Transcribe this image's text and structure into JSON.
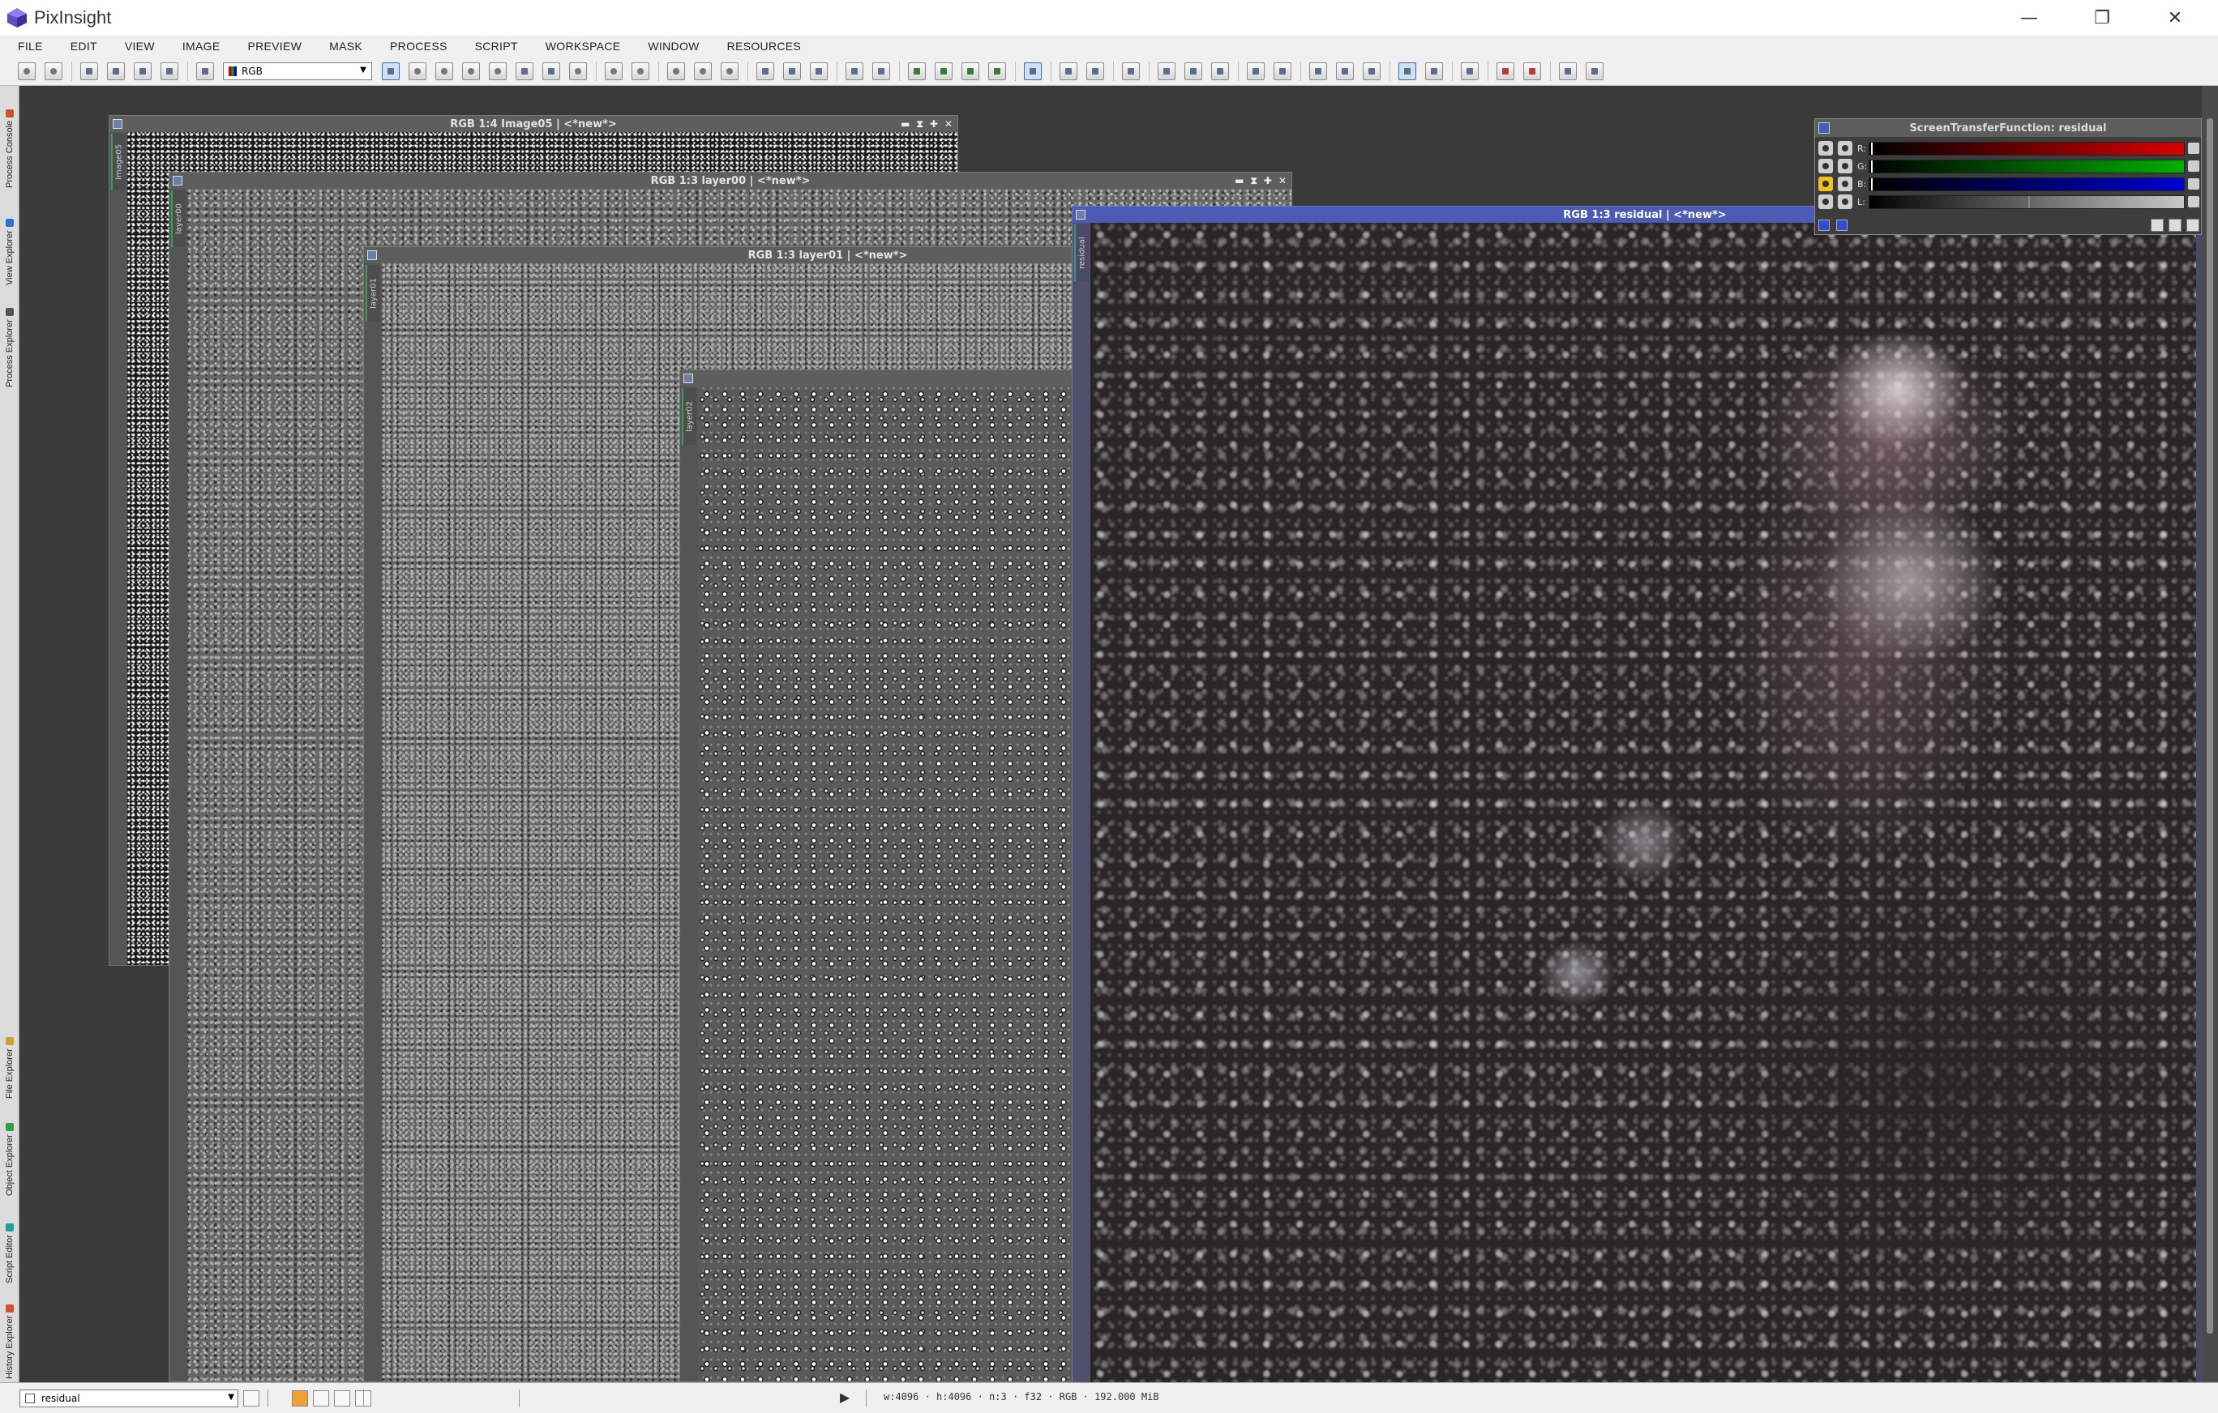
{
  "app": {
    "title": "PixInsight"
  },
  "window_controls": {
    "minimize": "—",
    "restore": "❐",
    "close": "✕"
  },
  "menu": [
    "FILE",
    "EDIT",
    "VIEW",
    "IMAGE",
    "PREVIEW",
    "MASK",
    "PROCESS",
    "SCRIPT",
    "WORKSPACE",
    "WINDOW",
    "RESOURCES"
  ],
  "toolbar": {
    "channel_select": "RGB"
  },
  "side_tabs": [
    "Process Console",
    "View Explorer",
    "Process Explorer",
    "File Explorer",
    "Object Explorer",
    "Script Editor",
    "History Explorer"
  ],
  "windows": {
    "image05": {
      "title": "RGB 1:4 Image05 | <*new*>",
      "tab": "Image05"
    },
    "layer00": {
      "title": "RGB 1:3 layer00 | <*new*>",
      "tab": "layer00"
    },
    "layer01": {
      "title": "RGB 1:3 layer01 | <*new*>",
      "tab": "layer01"
    },
    "layer02": {
      "title": "",
      "tab": "layer02"
    },
    "residual": {
      "title": "RGB 1:3 residual | <*new*>",
      "tab": "residual"
    }
  },
  "window_buttons": {
    "shade": "▬",
    "max": "⧗",
    "move": "✚",
    "close": "✕"
  },
  "stf": {
    "title": "ScreenTransferFunction: residual",
    "channels": [
      {
        "label": "R:",
        "color": "#d80000"
      },
      {
        "label": "G:",
        "color": "#00b000"
      },
      {
        "label": "B:",
        "color": "#0000d0"
      },
      {
        "label": "L:",
        "color": "#c8c8c8"
      }
    ]
  },
  "status": {
    "view": "residual",
    "info": "w:4096 · h:4096 · n:3 · f32 · RGB · 192.000 MiB",
    "play": "▶"
  }
}
